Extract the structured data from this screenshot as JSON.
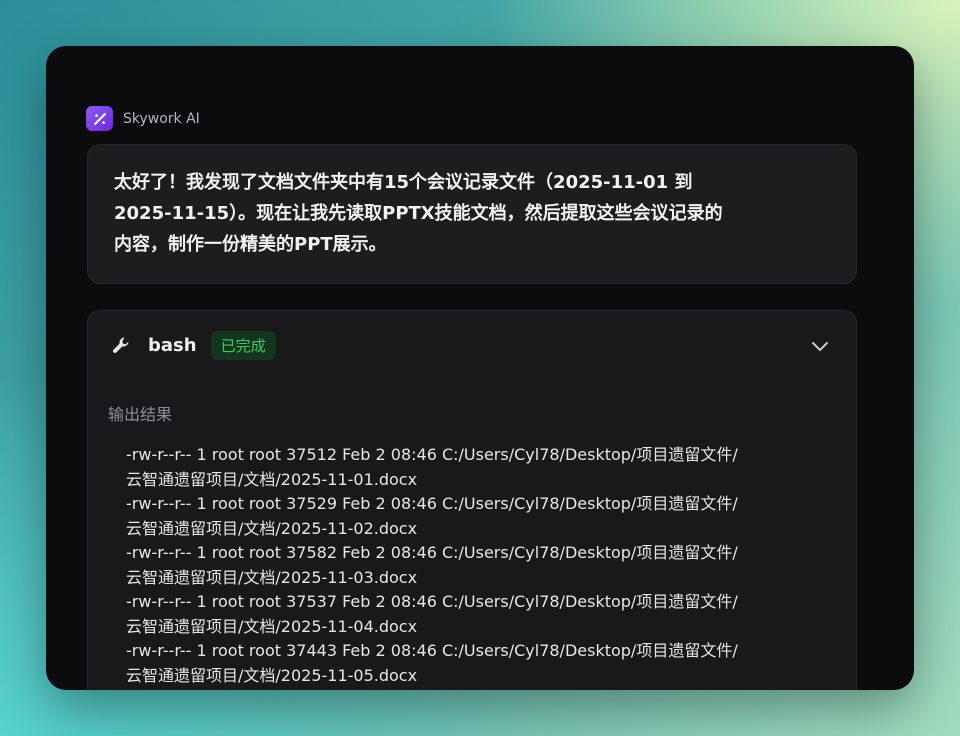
{
  "brand": {
    "name": "Skywork AI"
  },
  "message": {
    "lines": [
      "太好了！我发现了文档文件夹中有15个会议记录文件（2025-11-01 到",
      "2025-11-15）。现在让我先读取PPTX技能文档，然后提取这些会议记录的",
      "内容，制作一份精美的PPT展示。"
    ]
  },
  "tool": {
    "icon": "wrench-icon",
    "name": "bash",
    "status": "已完成",
    "status_color": "#3ccb62",
    "output_label": "输出结果",
    "output_lines": [
      "-rw-r--r-- 1 root root 37512 Feb  2 08:46 C:/Users/Cyl78/Desktop/项目遗留文件/",
      "云智通遗留项目/文档/2025-11-01.docx",
      "-rw-r--r-- 1 root root 37529 Feb  2 08:46 C:/Users/Cyl78/Desktop/项目遗留文件/",
      "云智通遗留项目/文档/2025-11-02.docx",
      "-rw-r--r-- 1 root root 37582 Feb  2 08:46 C:/Users/Cyl78/Desktop/项目遗留文件/",
      "云智通遗留项目/文档/2025-11-03.docx",
      "-rw-r--r-- 1 root root 37537 Feb  2 08:46 C:/Users/Cyl78/Desktop/项目遗留文件/",
      "云智通遗留项目/文档/2025-11-04.docx",
      "-rw-r--r-- 1 root root 37443 Feb  2 08:46 C:/Users/Cyl78/Desktop/项目遗留文件/",
      "云智通遗留项目/文档/2025-11-05.docx"
    ]
  },
  "colors": {
    "brand_accent": "#7c3aed",
    "window_bg": "#0c0c0e",
    "card_bg": "#19191c"
  }
}
